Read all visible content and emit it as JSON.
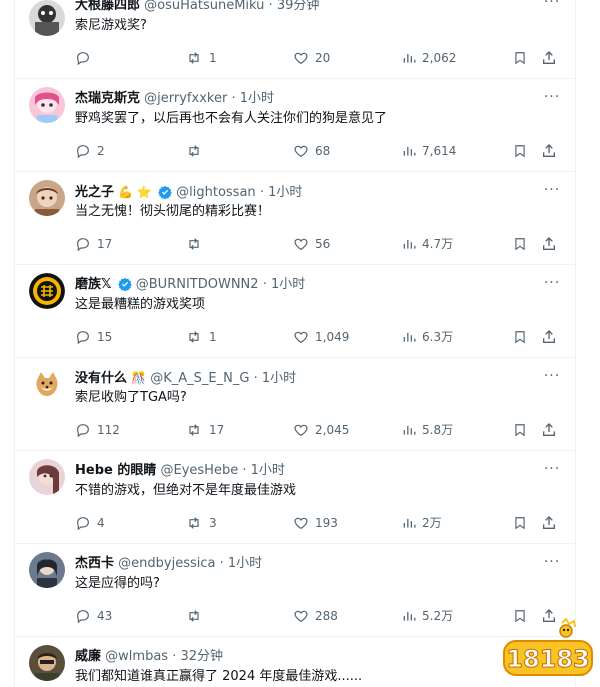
{
  "tweets": [
    {
      "name": "大根藤四郎",
      "emoji": "",
      "verified": false,
      "handle": "@osuHatsuneMiku",
      "time": "39分钟",
      "text": "索尼游戏奖?",
      "reply": "",
      "retweet": "1",
      "like": "20",
      "views": "2,062"
    },
    {
      "name": "杰瑞克斯克",
      "emoji": "",
      "verified": false,
      "handle": "@jerryfxxker",
      "time": "1小时",
      "text": "野鸡奖罢了，以后再也不会有人关注你们的狗是意见了",
      "reply": "2",
      "retweet": "",
      "like": "68",
      "views": "7,614"
    },
    {
      "name": "光之子",
      "emoji": "💪 ⭐",
      "verified": true,
      "handle": "@lightossan",
      "time": "1小时",
      "text": "当之无愧！彻头彻尾的精彩比赛！",
      "reply": "17",
      "retweet": "",
      "like": "56",
      "views": "4.7万"
    },
    {
      "name": "磨族𝕏",
      "emoji": "",
      "verified": true,
      "handle": "@BURNITDOWNN2",
      "time": "1小时",
      "text": "这是最糟糕的游戏奖项",
      "reply": "15",
      "retweet": "1",
      "like": "1,049",
      "views": "6.3万"
    },
    {
      "name": "没有什么",
      "emoji": "🎊",
      "verified": false,
      "handle": "@K_A_S_E_N_G",
      "time": "1小时",
      "text": "索尼收购了TGA吗?",
      "reply": "112",
      "retweet": "17",
      "like": "2,045",
      "views": "5.8万"
    },
    {
      "name": "Hebe 的眼睛",
      "emoji": "",
      "verified": false,
      "handle": "@EyesHebe",
      "time": "1小时",
      "text": "不错的游戏，但绝对不是年度最佳游戏",
      "reply": "4",
      "retweet": "3",
      "like": "193",
      "views": "2万"
    },
    {
      "name": "杰西卡",
      "emoji": "",
      "verified": false,
      "handle": "@endbyjessica",
      "time": "1小时",
      "text": "这是应得的吗?",
      "reply": "43",
      "retweet": "",
      "like": "288",
      "views": "5.2万"
    },
    {
      "name": "威廉",
      "emoji": "",
      "verified": false,
      "handle": "@wlmbas",
      "time": "32分钟",
      "text": "我们都知道谁真正赢得了 2024 年度最佳游戏......",
      "reply": "",
      "retweet": "",
      "like": "",
      "views": ""
    }
  ],
  "watermark": {
    "text": "18183"
  },
  "colors": {
    "text": "#0f1419",
    "secondary": "#536471",
    "divider": "#eff3f4",
    "verified": "#1d9bf0",
    "watermark": "#f7c325"
  }
}
